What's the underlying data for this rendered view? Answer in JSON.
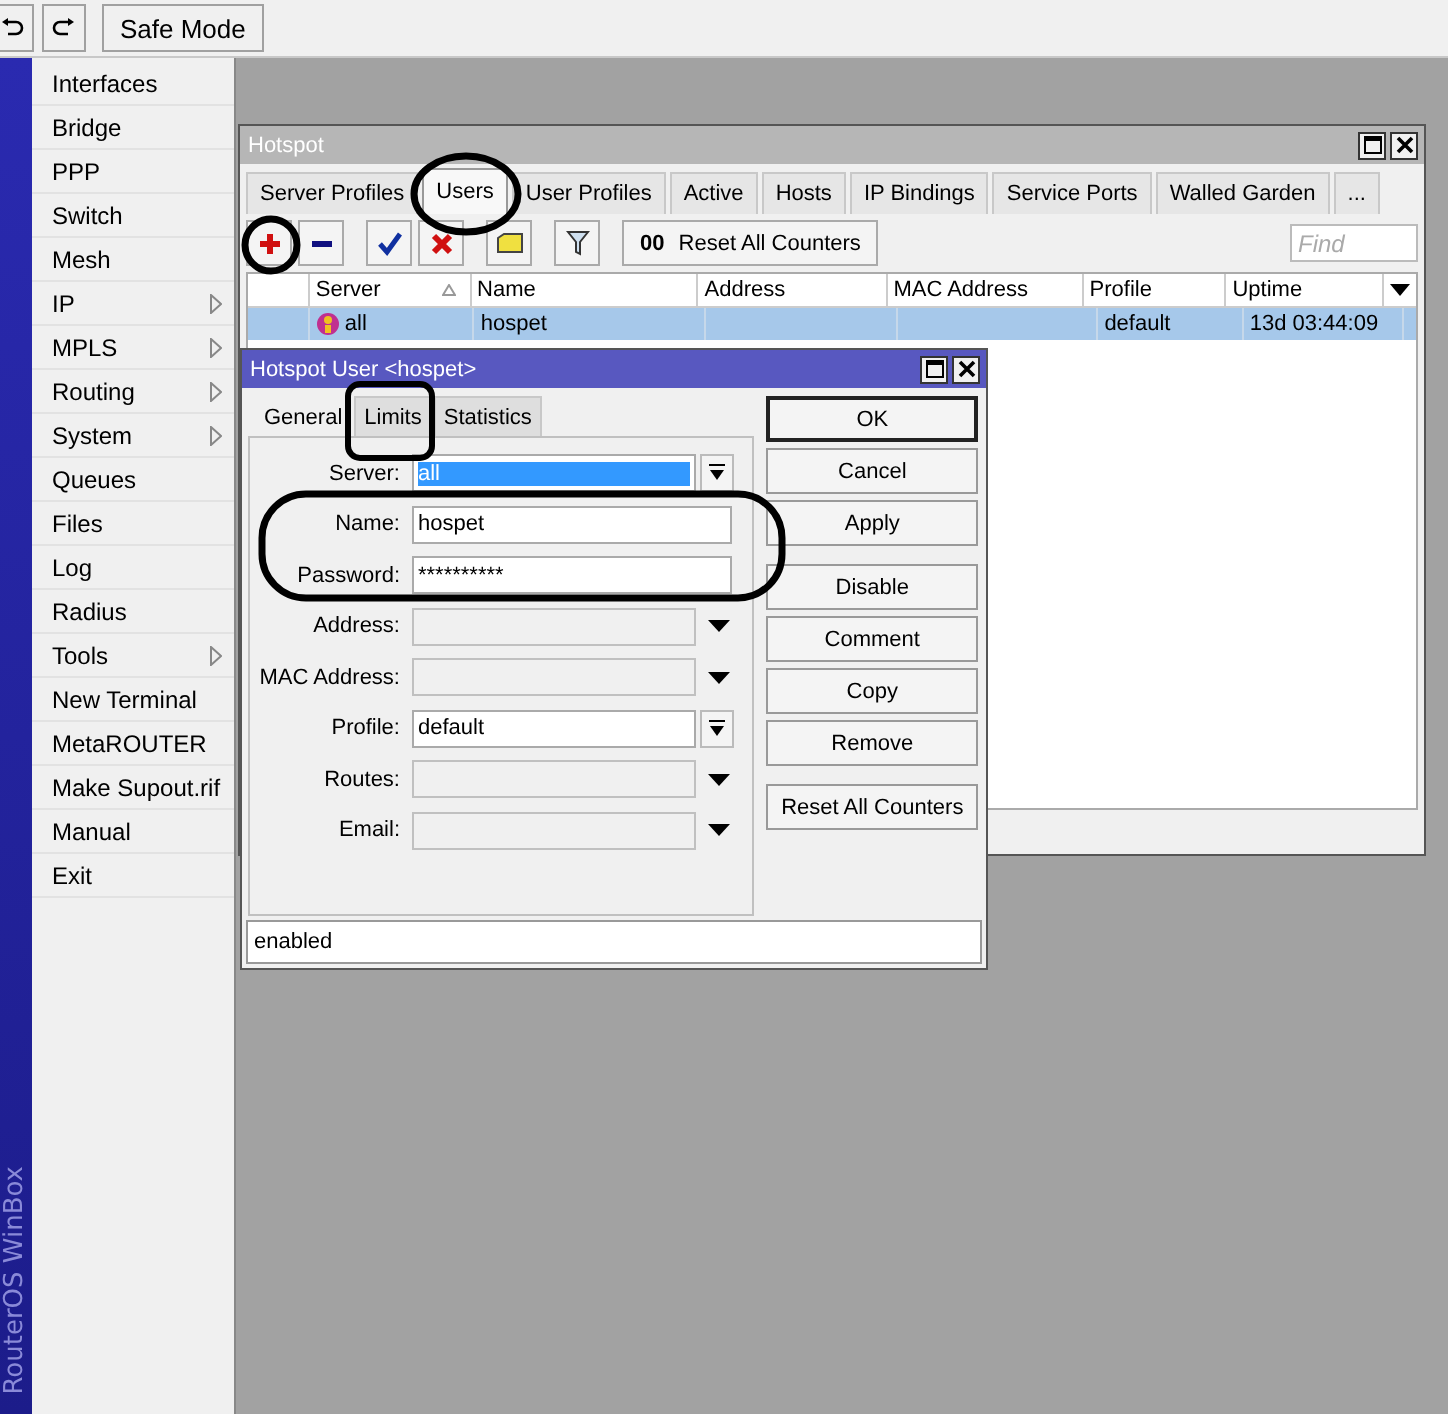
{
  "toolbar": {
    "safe_mode": "Safe Mode"
  },
  "sidebar": {
    "brand": "RouterOS WinBox",
    "items": [
      {
        "label": "Interfaces",
        "submenu": false
      },
      {
        "label": "Bridge",
        "submenu": false
      },
      {
        "label": "PPP",
        "submenu": false
      },
      {
        "label": "Switch",
        "submenu": false
      },
      {
        "label": "Mesh",
        "submenu": false
      },
      {
        "label": "IP",
        "submenu": true
      },
      {
        "label": "MPLS",
        "submenu": true
      },
      {
        "label": "Routing",
        "submenu": true
      },
      {
        "label": "System",
        "submenu": true
      },
      {
        "label": "Queues",
        "submenu": false
      },
      {
        "label": "Files",
        "submenu": false
      },
      {
        "label": "Log",
        "submenu": false
      },
      {
        "label": "Radius",
        "submenu": false
      },
      {
        "label": "Tools",
        "submenu": true
      },
      {
        "label": "New Terminal",
        "submenu": false
      },
      {
        "label": "MetaROUTER",
        "submenu": false
      },
      {
        "label": "Make Supout.rif",
        "submenu": false
      },
      {
        "label": "Manual",
        "submenu": false
      },
      {
        "label": "Exit",
        "submenu": false
      }
    ]
  },
  "hotspot_window": {
    "title": "Hotspot",
    "active": false,
    "tabs": [
      {
        "label": "Server Profiles",
        "selected": false
      },
      {
        "label": "Users",
        "selected": true
      },
      {
        "label": "User Profiles",
        "selected": false
      },
      {
        "label": "Active",
        "selected": false
      },
      {
        "label": "Hosts",
        "selected": false
      },
      {
        "label": "IP Bindings",
        "selected": false
      },
      {
        "label": "Service Ports",
        "selected": false
      },
      {
        "label": "Walled Garden",
        "selected": false
      },
      {
        "label": "...",
        "selected": false
      }
    ],
    "reset_button": {
      "icon_text": "00",
      "label": "Reset All Counters"
    },
    "find_placeholder": "Find",
    "table": {
      "columns": [
        {
          "label": "Server",
          "sorted": true
        },
        {
          "label": "Name",
          "sorted": false
        },
        {
          "label": "Address",
          "sorted": false
        },
        {
          "label": "MAC Address",
          "sorted": false
        },
        {
          "label": "Profile",
          "sorted": false
        },
        {
          "label": "Uptime",
          "sorted": false
        }
      ],
      "rows": [
        {
          "selected": true,
          "cells": [
            "all",
            "hospet",
            null,
            null,
            "default",
            "13d 03:44:09"
          ]
        }
      ]
    }
  },
  "user_dialog": {
    "title": "Hotspot User <hospet>",
    "active": true,
    "tabs": [
      {
        "label": "General",
        "selected": true
      },
      {
        "label": "Limits",
        "selected": false
      },
      {
        "label": "Statistics",
        "selected": false
      }
    ],
    "fields": [
      {
        "label": "Server:",
        "kind": "select",
        "value": "all",
        "highlighted": true
      },
      {
        "label": "Name:",
        "kind": "text",
        "value": "hospet",
        "highlighted": false
      },
      {
        "label": "Password:",
        "kind": "text",
        "value": "**********",
        "highlighted": false
      },
      {
        "label": "Address:",
        "kind": "dropdown"
      },
      {
        "label": "MAC Address:",
        "kind": "dropdown"
      },
      {
        "label": "Profile:",
        "kind": "select",
        "value": "default",
        "highlighted": false
      },
      {
        "label": "Routes:",
        "kind": "dropdown"
      },
      {
        "label": "Email:",
        "kind": "dropdown"
      }
    ],
    "button_groups": [
      [
        {
          "label": "OK",
          "default": true
        },
        {
          "label": "Cancel",
          "default": false
        },
        {
          "label": "Apply",
          "default": false
        }
      ],
      [
        {
          "label": "Disable",
          "default": false
        },
        {
          "label": "Comment",
          "default": false
        },
        {
          "label": "Copy",
          "default": false
        },
        {
          "label": "Remove",
          "default": false
        }
      ],
      [
        {
          "label": "Reset All Counters",
          "default": false
        }
      ]
    ],
    "status": "enabled"
  }
}
